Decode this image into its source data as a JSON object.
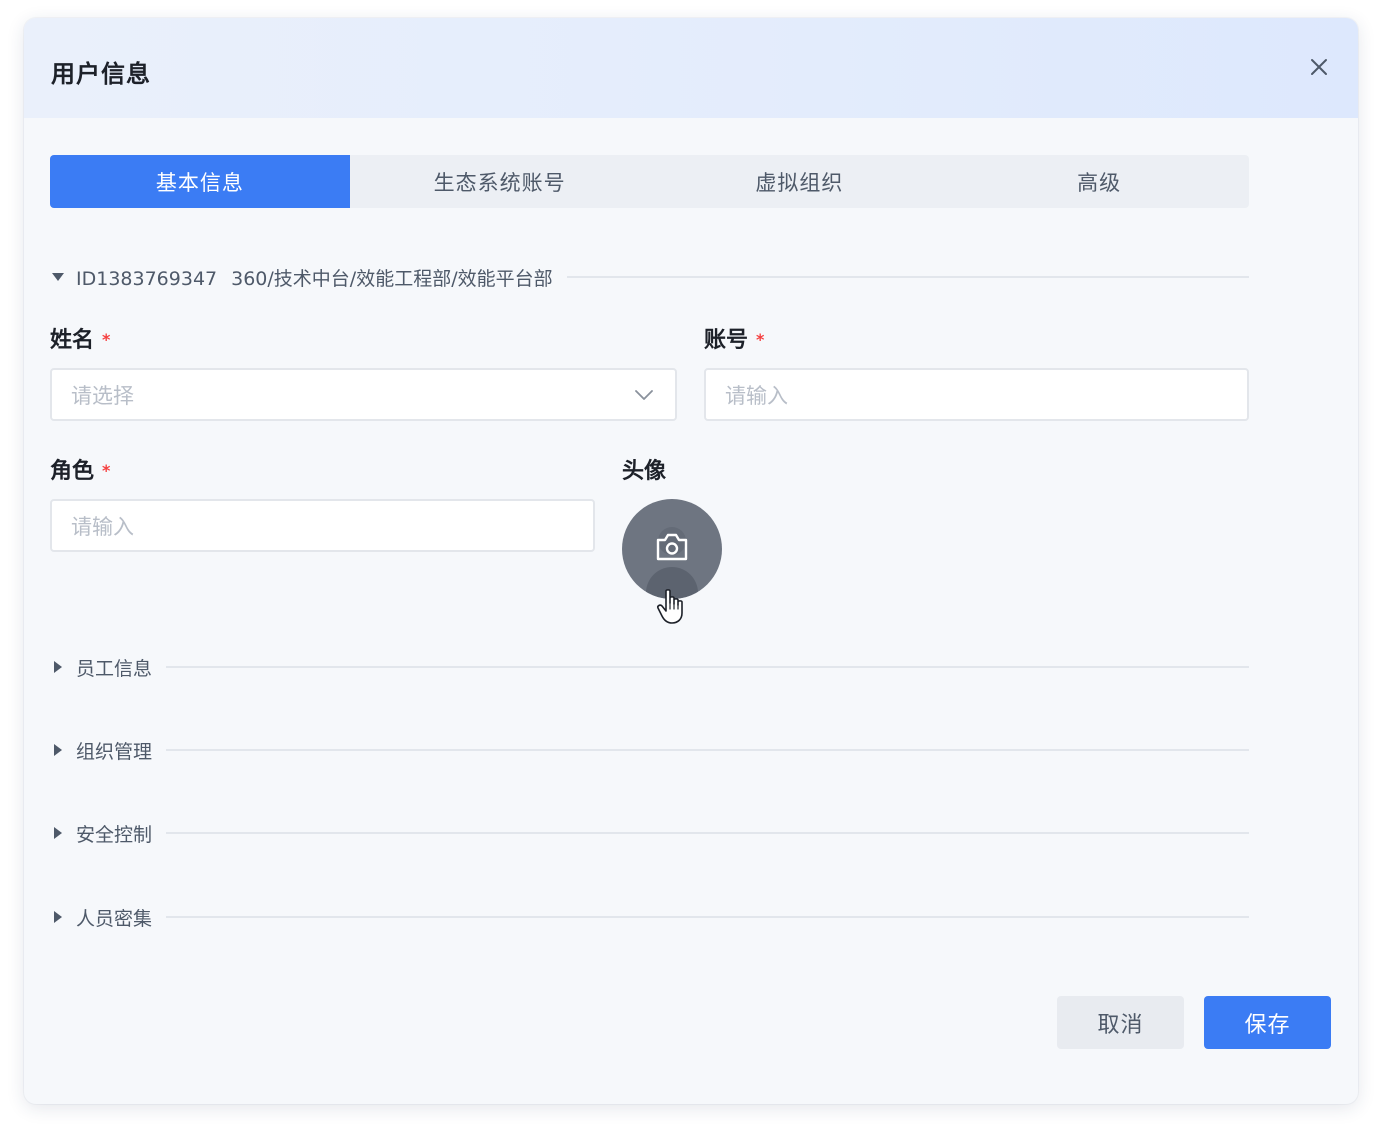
{
  "dialog": {
    "title": "用户信息"
  },
  "tabs": [
    {
      "label": "基本信息",
      "active": true
    },
    {
      "label": "生态系统账号",
      "active": false
    },
    {
      "label": "虚拟组织",
      "active": false
    },
    {
      "label": "高级",
      "active": false
    }
  ],
  "basic_section": {
    "id": "ID1383769347",
    "path": "360/技术中台/效能工程部/效能平台部",
    "expanded": true
  },
  "fields": {
    "name": {
      "label": "姓名",
      "required_mark": "*",
      "placeholder": "请选择"
    },
    "account": {
      "label": "账号",
      "required_mark": "*",
      "placeholder": "请输入"
    },
    "role": {
      "label": "角色",
      "required_mark": "*",
      "placeholder": "请输入"
    },
    "avatar": {
      "label": "头像"
    }
  },
  "collapsed_sections": [
    {
      "label": "员工信息"
    },
    {
      "label": "组织管理"
    },
    {
      "label": "安全控制"
    },
    {
      "label": "人员密集"
    }
  ],
  "footer": {
    "cancel_label": "取消",
    "save_label": "保存"
  },
  "colors": {
    "primary": "#3b7cf4",
    "required": "#f53f3f"
  }
}
